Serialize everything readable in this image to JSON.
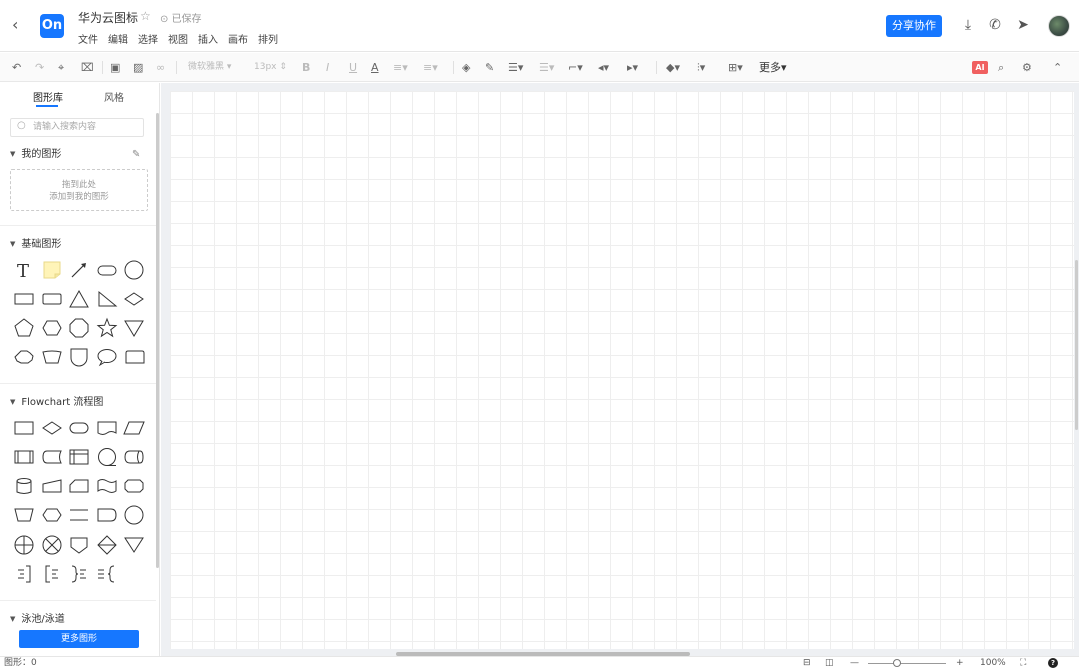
{
  "header": {
    "back_icon": "chevron-left-icon",
    "logo_text": "On",
    "title": "华为云图标",
    "saved_status": "已保存",
    "menu": [
      "文件",
      "编辑",
      "选择",
      "视图",
      "插入",
      "画布",
      "排列"
    ],
    "share_label": "分享协作",
    "icons": [
      "download-icon",
      "phone-icon",
      "send-icon"
    ]
  },
  "toolbar": {
    "font_family": "微软雅黑",
    "font_size": "13px",
    "more_label": "更多",
    "ai_label": "AI"
  },
  "sidebar": {
    "tabs": [
      "图形库",
      "风格"
    ],
    "active_tab": "图形库",
    "search_placeholder": "请输入搜索内容",
    "my_shapes": {
      "title": "我的图形",
      "drop_line1": "拖到此处",
      "drop_line2": "添加到我的图形"
    },
    "basic_shapes": {
      "title": "基础图形"
    },
    "flowchart": {
      "title": "Flowchart 流程图"
    },
    "swimlane": {
      "title": "泳池/泳道"
    },
    "more_shapes_label": "更多图形"
  },
  "statusbar": {
    "shape_count": "图形：0",
    "zoom": "100%"
  },
  "colors": {
    "accent": "#1677ff",
    "ai_badge": "#f06060",
    "note_yellow": "#fff4b8"
  }
}
